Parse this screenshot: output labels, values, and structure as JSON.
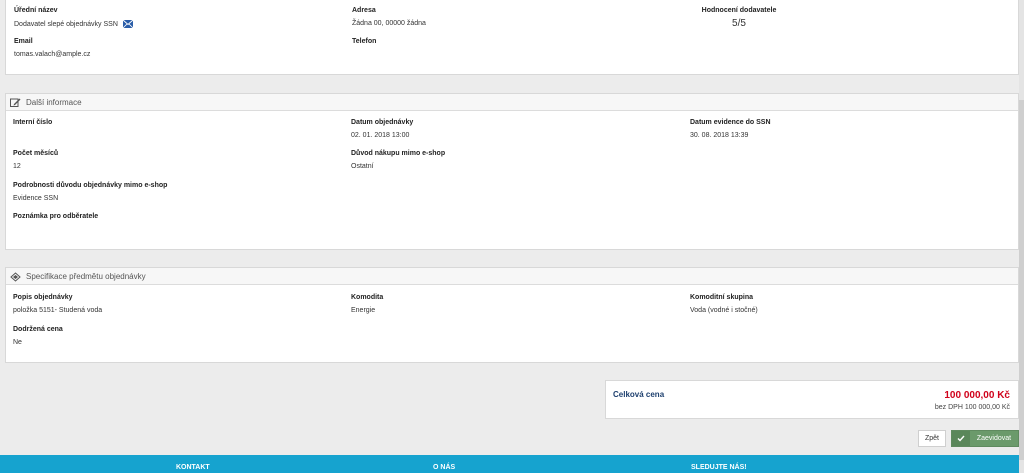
{
  "supplier": {
    "official_name_label": "Úřední název",
    "official_name_value": "Dodavatel slepé objednávky SSN",
    "address_label": "Adresa",
    "address_value": "Žádna 00, 00000 žádna",
    "rating_label": "Hodnocení dodavatele",
    "rating_value": "5/5",
    "email_label": "Email",
    "email_value": "tomas.valach@ample.cz",
    "phone_label": "Telefon",
    "phone_value": ""
  },
  "additional": {
    "title": "Další informace",
    "internal_number_label": "Interní číslo",
    "internal_number_value": "",
    "order_date_label": "Datum objednávky",
    "order_date_value": "02. 01. 2018 13:00",
    "ssn_date_label": "Datum evidence do SSN",
    "ssn_date_value": "30. 08. 2018 13:39",
    "months_label": "Počet měsíců",
    "months_value": "12",
    "reason_label": "Důvod nákupu mimo e-shop",
    "reason_value": "Ostatní",
    "reason_details_label": "Podrobnosti důvodu objednávky mimo e-shop",
    "reason_details_value": "Evidence SSN",
    "note_label": "Poznámka pro odběratele",
    "note_value": ""
  },
  "specification": {
    "title": "Specifikace předmětu objednávky",
    "description_label": "Popis objednávky",
    "description_value": "položka 5151- Studená voda",
    "commodity_label": "Komodita",
    "commodity_value": "Energie",
    "commodity_group_label": "Komoditní skupina",
    "commodity_group_value": "Voda (vodné i stočné)",
    "kept_price_label": "Dodržená cena",
    "kept_price_value": "Ne"
  },
  "total": {
    "label": "Celková cena",
    "price": "100 000,00 Kč",
    "net": "bez DPH 100 000,00 Kč"
  },
  "actions": {
    "back_label": "Zpět",
    "submit_label": "Zaevidovat"
  },
  "footer": {
    "contact": "KONTAKT",
    "about": "O NÁS",
    "follow": "SLEDUJTE NÁS!"
  },
  "colors": {
    "accent_red": "#d0021b",
    "label_blue": "#1d3f6e",
    "footer_blue": "#16a3cf",
    "submit_green": "#6b9a6b"
  }
}
